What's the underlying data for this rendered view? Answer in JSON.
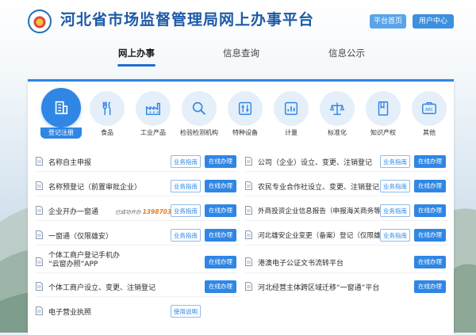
{
  "header": {
    "site_title": "河北省市场监督管理局网上办事平台",
    "home_button": "平台首页",
    "user_button": "用户中心"
  },
  "nav": {
    "tabs": [
      {
        "label": "网上办事",
        "active": true
      },
      {
        "label": "信息查询",
        "active": false
      },
      {
        "label": "信息公示",
        "active": false
      }
    ]
  },
  "categories": [
    {
      "label": "登记注册",
      "icon": "building-icon",
      "active": true
    },
    {
      "label": "食品",
      "icon": "fork-knife-icon",
      "active": false
    },
    {
      "label": "工业产品",
      "icon": "factory-icon",
      "active": false
    },
    {
      "label": "检验检测机构",
      "icon": "magnifier-icon",
      "active": false
    },
    {
      "label": "特种设备",
      "icon": "equipment-icon",
      "active": false
    },
    {
      "label": "计量",
      "icon": "chart-icon",
      "active": false
    },
    {
      "label": "标准化",
      "icon": "scale-icon",
      "active": false
    },
    {
      "label": "知识产权",
      "icon": "book-icon",
      "active": false
    },
    {
      "label": "其他",
      "icon": "abc-card-icon",
      "active": false
    }
  ],
  "services_left": [
    {
      "text": "名称自主申报",
      "guide": "业务指南",
      "go": "在线办理"
    },
    {
      "text": "名称预登记（前置审批企业）",
      "guide": "业务指南",
      "go": "在线办理"
    },
    {
      "text": "企业开办一窗通",
      "stat_label": "已成功开办",
      "stat_value": "1398703",
      "stat_unit": "户",
      "guide": "业务指南",
      "go": "在线办理"
    },
    {
      "text": "一窗通（仅限雄安）",
      "guide": "业务指南",
      "go": "在线办理"
    },
    {
      "text_line1": "个体工商户登记手机办",
      "text_line2": "“云窗办照”APP",
      "go": "在线办理"
    },
    {
      "text": "个体工商户设立、变更、注销登记",
      "go": "在线办理"
    },
    {
      "text": "电子营业执照",
      "usage": "使用说明"
    }
  ],
  "services_right": [
    {
      "text": "公司（企业）设立、变更、注销登记",
      "guide": "业务指南",
      "go": "在线办理"
    },
    {
      "text": "农民专业合作社设立、变更、注销登记",
      "guide": "业务指南",
      "go": "在线办理"
    },
    {
      "text": "外商投资企业信息报告（申报海关商务等）",
      "guide": "业务指南",
      "go": "在线办理"
    },
    {
      "text": "河北雄安企业变更（备案）登记（仅限雄...",
      "guide": "业务指南",
      "go": "在线办理"
    },
    {
      "text": "港澳电子公证文书流转平台",
      "go": "在线办理"
    },
    {
      "text": "河北经营主体跨区域迁移“一窗通”平台",
      "go": "在线办理"
    }
  ],
  "colors": {
    "accent": "#2f86e4",
    "title": "#1c5aa6",
    "stat": "#e87d1a"
  }
}
